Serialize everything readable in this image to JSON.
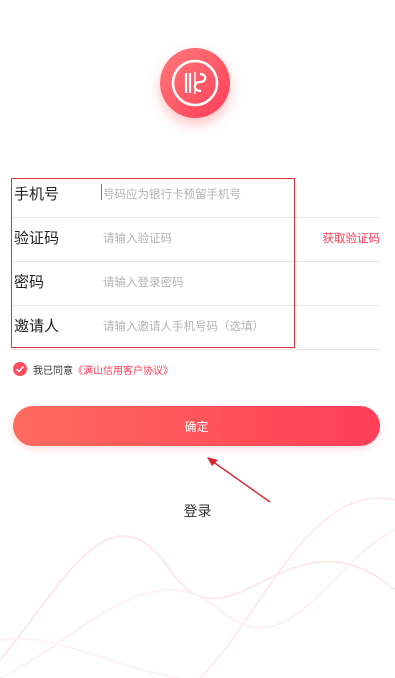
{
  "logo": {
    "icon": "brand-logo-icon"
  },
  "form": {
    "phone": {
      "label": "手机号",
      "placeholder": "号码应为银行卡预留手机号"
    },
    "code": {
      "label": "验证码",
      "placeholder": "请输入验证码",
      "send_label": "获取验证码"
    },
    "password": {
      "label": "密码",
      "placeholder": "请输入登录密码"
    },
    "inviter": {
      "label": "邀请人",
      "placeholder": "请输入邀请人手机号码（选填）"
    }
  },
  "agreement": {
    "checked": true,
    "prefix": "我已同意",
    "link": "《满山信用客户协议》"
  },
  "buttons": {
    "confirm": "确定",
    "login": "登录"
  },
  "colors": {
    "accent": "#ff3d57",
    "accent_start": "#ff6b5e",
    "annotation": "#e0303b"
  }
}
